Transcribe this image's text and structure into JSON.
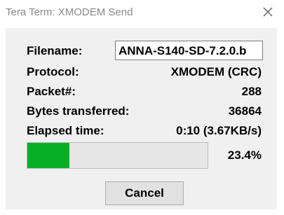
{
  "window": {
    "title": "Tera Term: XMODEM Send",
    "close_icon": "close-icon"
  },
  "fields": {
    "filename_label": "Filename:",
    "filename_value": "ANNA-S140-SD-7.2.0.b",
    "protocol_label": "Protocol:",
    "protocol_value": "XMODEM (CRC)",
    "packet_label": "Packet#:",
    "packet_value": "288",
    "bytes_label": "Bytes transferred:",
    "bytes_value": "36864",
    "elapsed_label": "Elapsed time:",
    "elapsed_value": "0:10 (3.67KB/s)"
  },
  "progress": {
    "fraction": 0.234,
    "percent_text": "23.4%",
    "fill_color": "#06b025"
  },
  "buttons": {
    "cancel_label": "Cancel"
  }
}
